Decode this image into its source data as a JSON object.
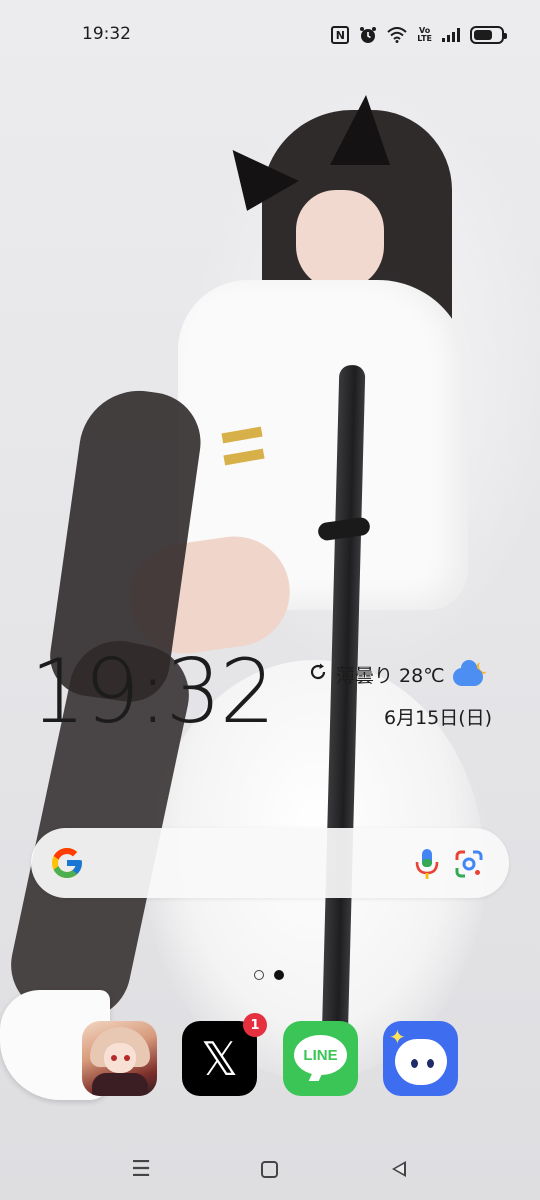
{
  "status_bar": {
    "time": "19:32",
    "icons": [
      "nfc-icon",
      "alarm-icon",
      "wifi-icon",
      "volte-icon",
      "signal-icon",
      "battery-icon"
    ],
    "volte_top": "Vo",
    "volte_bottom": "LTE",
    "nfc_letter": "N",
    "battery_level": 0.7
  },
  "clock_widget": {
    "time": "19:32",
    "weather_text": "薄曇り 28℃",
    "date": "6月15日(日)",
    "weather_icon": "partly-cloudy-night-icon",
    "refresh_icon": "refresh-icon"
  },
  "search_bar": {
    "logo": "google-logo-icon",
    "mic_icon": "mic-icon",
    "lens_icon": "google-lens-icon"
  },
  "page_indicator": {
    "pages": 2,
    "current": 2
  },
  "dock": {
    "apps": [
      {
        "name": "game-app",
        "icon": "anime-character-icon"
      },
      {
        "name": "x-app",
        "icon": "x-logo-icon",
        "glyph": "𝕏",
        "badge": "1"
      },
      {
        "name": "line-app",
        "icon": "line-logo-icon",
        "label": "LINE"
      },
      {
        "name": "blue-app",
        "icon": "mascot-icon"
      }
    ]
  },
  "nav_bar": {
    "menu_glyph": "☰",
    "icons": [
      "menu-icon",
      "home-icon",
      "back-icon"
    ]
  },
  "colors": {
    "x_badge": "#e5313f",
    "line_green": "#3ac556",
    "blue_app": "#3f6df0",
    "weather_cloud": "#4c8ef2"
  }
}
